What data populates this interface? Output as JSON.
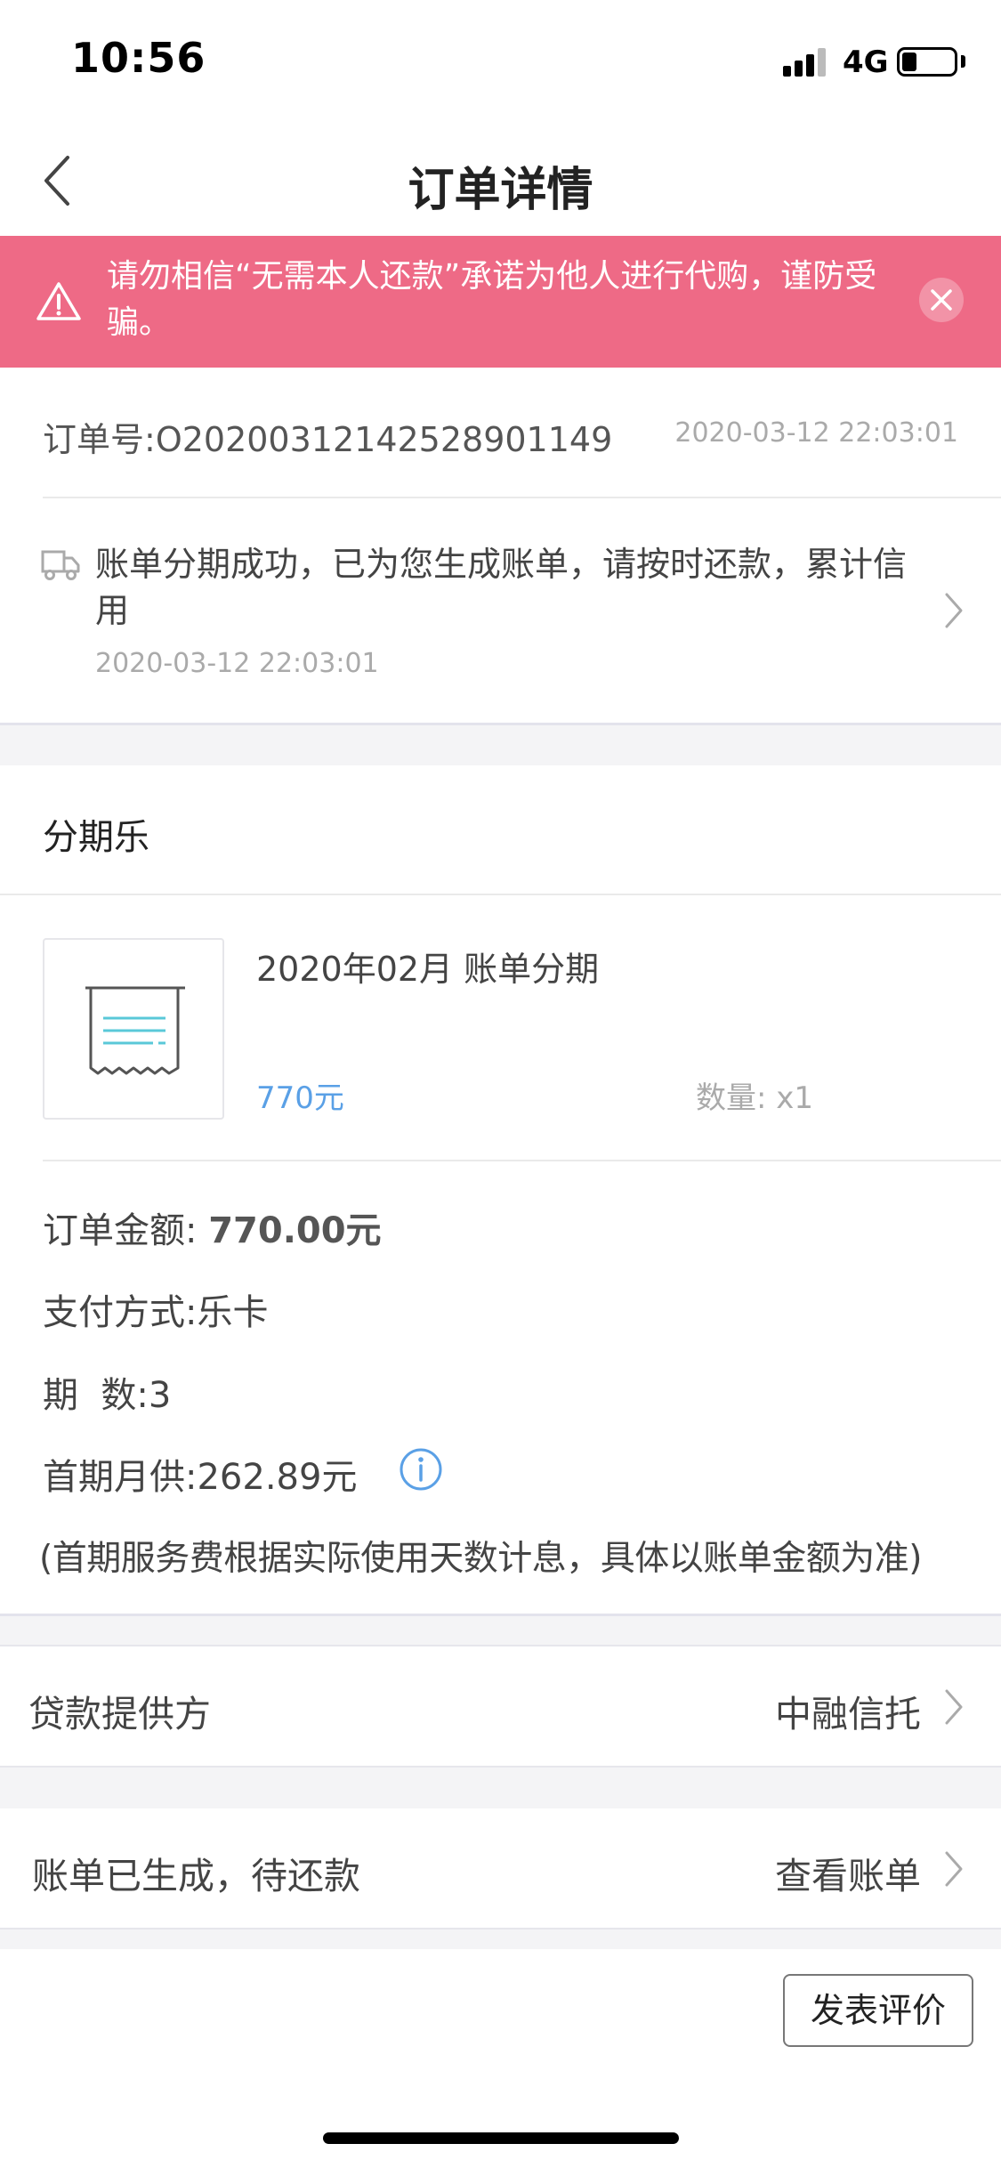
{
  "status_bar": {
    "time": "10:56",
    "network": "4G"
  },
  "nav": {
    "title": "订单详情",
    "back_icon": "chevron-left-icon"
  },
  "warning": {
    "text": "请勿相信“无需本人还款”承诺为他人进行代购，谨防受骗。",
    "icon": "warning-triangle-icon",
    "close_icon": "close-icon",
    "background": "#ee6a86"
  },
  "order": {
    "number_label": "订单号:",
    "number": "O20200312142528901149",
    "time": "2020-03-12 22:03:01"
  },
  "logistics": {
    "message": "账单分期成功，已为您生成账单，请按时还款，累计信用",
    "time": "2020-03-12 22:03:01",
    "icon": "truck-icon"
  },
  "shop": {
    "name": "分期乐"
  },
  "product": {
    "title": "2020年02月 账单分期",
    "price": "770元",
    "quantity": "数量: x1",
    "thumb_icon": "receipt-icon"
  },
  "details": {
    "amount_label": "订单金额:",
    "amount_value": "770.00元",
    "payment_label": "支付方式:",
    "payment_value": "乐卡",
    "periods_label": "期  数:",
    "periods_value": "3",
    "first_month_label": "首期月供:",
    "first_month_value": "262.89元",
    "note": "(首期服务费根据实际使用天数计息，具体以账单金额为准)"
  },
  "lender": {
    "label": "贷款提供方",
    "value": "中融信托"
  },
  "bill": {
    "label": "账单已生成，待还款",
    "action": "查看账单"
  },
  "actions": {
    "review_button": "发表评价"
  },
  "colors": {
    "accent_blue": "#5aa0e6",
    "warning_pink": "#ee6a86"
  }
}
